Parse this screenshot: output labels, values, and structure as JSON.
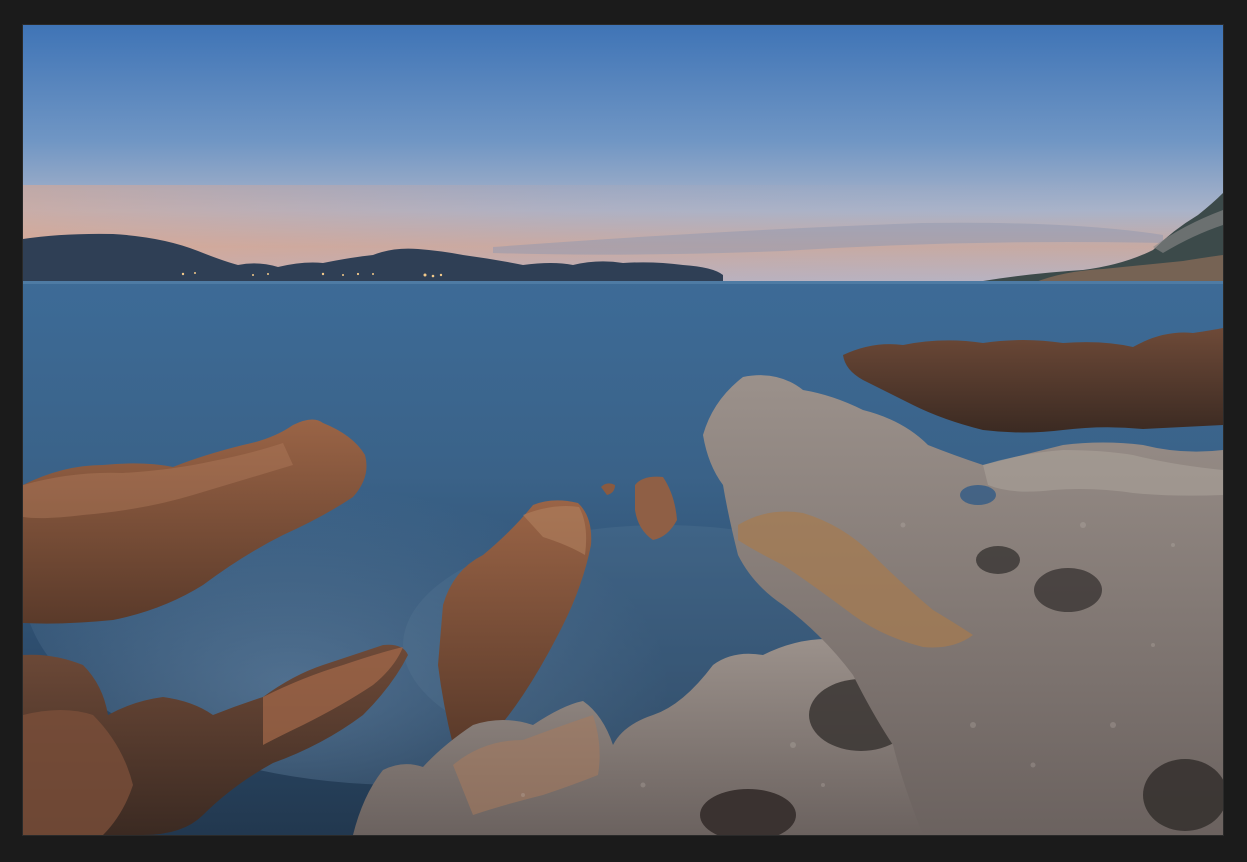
{
  "photo": {
    "subject": "",
    "colors": {
      "frame": "#1b1b1b",
      "sky_top": "#4a79b8",
      "sky_horizon": "#c9a59a",
      "sea_far": "#3f6f9a",
      "sea_near": "#2a4663",
      "rock_warm": "#8a5a3e",
      "rock_cool": "#8c8581",
      "mountains": "#2e3d52"
    }
  }
}
